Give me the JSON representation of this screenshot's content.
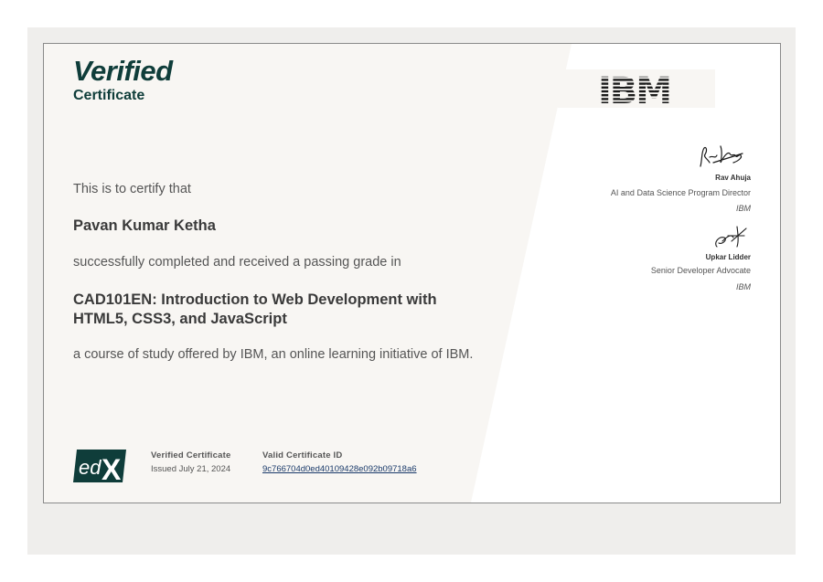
{
  "header": {
    "title": "Verified",
    "subtitle": "Certificate"
  },
  "body": {
    "certify_text": "This is to certify that",
    "recipient_name": "Pavan Kumar Ketha",
    "completion_text": "successfully completed and received a passing grade in",
    "course_title": "CAD101EN: Introduction to Web Development with HTML5, CSS3, and JavaScript",
    "offered_by_text": "a course of study offered by IBM, an online learning initiative of IBM."
  },
  "footer": {
    "cert_type_label": "Verified Certificate",
    "issued_date": "Issued July 21, 2024",
    "cert_id_label": "Valid Certificate ID",
    "cert_id": "9c766704d0ed40109428e092b09718a6"
  },
  "logos": {
    "partner": "IBM",
    "platform": "edX"
  },
  "signatories": [
    {
      "name": "Rav Ahuja",
      "title": "AI and Data Science Program Director",
      "org": "IBM"
    },
    {
      "name": "Upkar Lidder",
      "title": "Senior Developer Advocate",
      "org": "IBM"
    }
  ],
  "colors": {
    "brand_dark_green": "#0f3d3a",
    "panel_bg": "#f8f6f3",
    "page_bg": "#efeeec"
  }
}
